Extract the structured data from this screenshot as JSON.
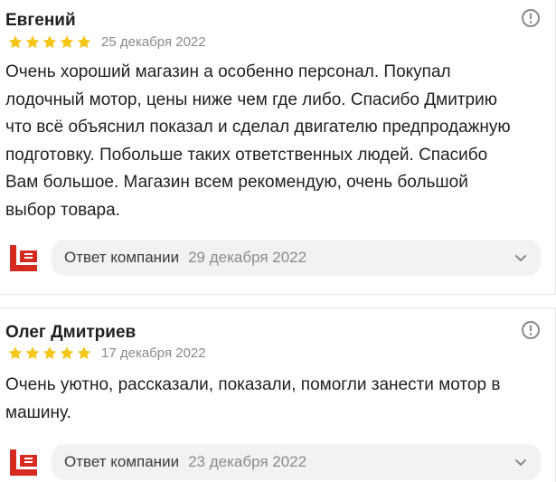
{
  "reviews": [
    {
      "author": "Евгений",
      "rating": 5,
      "date": "25 декабря 2022",
      "text": "Очень хороший магазин а особенно персонал. Покупал\nлодочный мотор, цены ниже чем где либо. Спасибо Дмитрию\nчто всё объяснил показал и сделал двигателю предпродажную\nподготовку. Побольше таких ответственных людей. Спасибо\nВам большое. Магазин всем рекомендую, очень большой\nвыбор товара.",
      "reply": {
        "label": "Ответ компании",
        "date": "29 декабря 2022"
      }
    },
    {
      "author": "Олег Дмитриев",
      "rating": 5,
      "date": "17 декабря 2022",
      "text": "Очень уютно, рассказали, показали, помогли занести мотор в\nмашину.",
      "reply": {
        "label": "Ответ компании",
        "date": "23 декабря 2022"
      }
    }
  ],
  "icons": {
    "star": "star-icon",
    "more": "info-circle-icon",
    "chevron": "chevron-down-icon",
    "logo": "company-logo"
  },
  "colors": {
    "star": "#f5c518",
    "logo_red": "#d62b20",
    "muted_text": "#8a8a8a",
    "pill_bg": "#f2f2f2"
  }
}
